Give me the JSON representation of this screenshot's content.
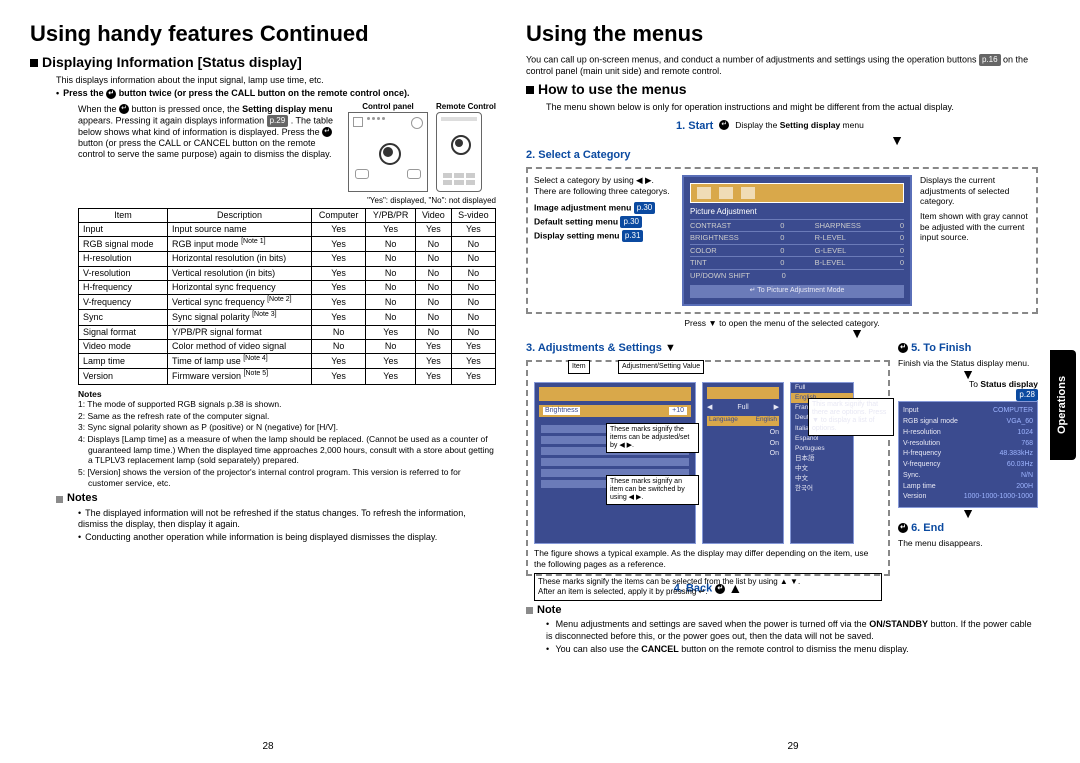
{
  "left": {
    "h1": "Using handy features Continued",
    "h2": "Displaying Information [Status display]",
    "intro": "This displays information about the input signal, lamp use time, etc.",
    "step_line_a": "Press the ",
    "step_line_b": " button twice (or press the CALL button on the remote control once).",
    "explain_a": "When the ",
    "explain_b": " button is pressed once, the ",
    "explain_c": "Setting display menu",
    "explain_d": " appears. Pressing it again displays information ",
    "explain_e": " . The table below shows what kind of information is displayed. Press the ",
    "explain_f": " button (or press the CALL or CANCEL button on the remote control to serve the same purpose) again to dismiss the display.",
    "page_ref_small": "p.29",
    "panel_label": "Control panel",
    "remote_label": "Remote Control",
    "table_legend": "\"Yes\": displayed, \"No\": not displayed",
    "table": {
      "head": [
        "Item",
        "Description",
        "Computer",
        "Y/PB/PR",
        "Video",
        "S-video"
      ],
      "rows": [
        [
          "Input",
          "Input source name",
          "Yes",
          "Yes",
          "Yes",
          "Yes"
        ],
        [
          "RGB signal mode",
          "RGB input mode [Note 1]",
          "Yes",
          "No",
          "No",
          "No"
        ],
        [
          "H-resolution",
          "Horizontal resolution (in bits)",
          "Yes",
          "No",
          "No",
          "No"
        ],
        [
          "V-resolution",
          "Vertical resolution (in bits)",
          "Yes",
          "No",
          "No",
          "No"
        ],
        [
          "H-frequency",
          "Horizontal sync frequency",
          "Yes",
          "No",
          "No",
          "No"
        ],
        [
          "V-frequency",
          "Vertical sync frequency [Note 2]",
          "Yes",
          "No",
          "No",
          "No"
        ],
        [
          "Sync",
          "Sync signal polarity [Note 3]",
          "Yes",
          "No",
          "No",
          "No"
        ],
        [
          "Signal format",
          "Y/PB/PR signal format",
          "No",
          "Yes",
          "No",
          "No"
        ],
        [
          "Video mode",
          "Color method of video signal",
          "No",
          "No",
          "Yes",
          "Yes"
        ],
        [
          "Lamp time",
          "Time of lamp use [Note 4]",
          "Yes",
          "Yes",
          "Yes",
          "Yes"
        ],
        [
          "Version",
          "Firmware version [Note 5]",
          "Yes",
          "Yes",
          "Yes",
          "Yes"
        ]
      ]
    },
    "notes_head": "Notes",
    "notes": [
      "1: The mode of supported RGB signals p.38 is shown.",
      "2: Same as the refresh rate of the computer signal.",
      "3: Sync signal polarity shown as P (positive) or N (negative) for [H/V].",
      "4: Displays [Lamp time] as a measure of when the lamp should be replaced. (Cannot be used as a counter of guaranteed lamp time.) When the displayed time approaches 2,000 hours, consult with a store about getting a TLPLV3 replacement lamp (sold separately) prepared.",
      "5: [Version] shows the version of the projector's internal control program. This version is referred to for customer service, etc."
    ],
    "notes2_head": "Notes",
    "notes2": [
      "The displayed information will not be refreshed if the status changes. To refresh the information, dismiss the display, then display it again.",
      "Conducting another operation while information is being displayed dismisses the display."
    ],
    "page_num": "28"
  },
  "right": {
    "h1": "Using the menus",
    "intro_a": "You can call up on-screen menus, and conduct a number of adjustments and settings using the operation buttons ",
    "intro_ref": "p.16",
    "intro_b": " on the control panel (main unit side) and remote control.",
    "h2": "How to use the menus",
    "h2_sub": "The menu shown below is only for operation instructions and might be different from the actual display.",
    "step1": "1. Start",
    "step1_text_a": "Display the ",
    "step1_text_b": "Setting display",
    "step1_text_c": " menu",
    "step2": "2. Select a Category",
    "step2_text": "Select a category by using ◀ ▶.\nThere are following three categorys.",
    "menu_img": "Image adjustment menu",
    "menu_def": "Default setting menu",
    "menu_disp": "Display setting menu",
    "ref30": "p.30",
    "ref31": "p.31",
    "osd_title": "Picture Adjustment",
    "osd_rows": [
      [
        "CONTRAST",
        "0",
        "SHARPNESS",
        "0"
      ],
      [
        "BRIGHTNESS",
        "0",
        "R-LEVEL",
        "0"
      ],
      [
        "COLOR",
        "0",
        "G-LEVEL",
        "0"
      ],
      [
        "TINT",
        "0",
        "B-LEVEL",
        "0"
      ],
      [
        "UP/DOWN SHIFT",
        "0",
        "",
        ""
      ]
    ],
    "osd_foot": "↵ To Picture Adjustment Mode",
    "osd_side_a": "Displays the current adjustments of selected category.",
    "osd_side_b": "Item shown with gray cannot be adjusted with the current input source.",
    "press_open": "Press ▼ to open the menu of the selected category.",
    "step3": "3. Adjustments & Settings",
    "callout_item": "Item",
    "callout_val": "Adjustment/Setting Value",
    "callout_marks1": "These marks signify the items can be adjusted/set by ◀ ▶.",
    "callout_marks2": "These marks signify an item can be switched by using ◀ ▶.",
    "callout_marks3": "This mark signify that there are options. Press ▼ to display a list of options.",
    "step3_text": "The figure shows a typical example. As the display may differ depending on the item, use the following pages as a reference.",
    "step3_box": "These marks signify the items can be selected from the list by using ▲ ▼.\nAfter an item is selected, apply it by pressing ↵.",
    "step4": "4. Back",
    "step5": "5. To Finish",
    "step5_text": "Finish via the Status display menu.",
    "to_status": "To Status display",
    "ref28": "p.28",
    "status_osd": {
      "rows": [
        [
          "Input",
          "COMPUTER"
        ],
        [
          "RGB signal mode",
          "VGA_60"
        ],
        [
          "H-resolution",
          "1024"
        ],
        [
          "V-resolution",
          "768"
        ],
        [
          "H-frequency",
          "48.383kHz"
        ],
        [
          "V-frequency",
          "60.03Hz"
        ],
        [
          "Sync.",
          "N/N"
        ],
        [
          "Lamp time",
          "200H"
        ],
        [
          "Version",
          "1000-1000-1000-1000"
        ]
      ]
    },
    "step6": "6. End",
    "step6_text": "The menu disappears.",
    "note_head": "Note",
    "note1_a": "Menu adjustments and settings are saved when the power is turned off via the ",
    "note1_b": "ON/STANDBY",
    "note1_c": " button. If the power cable is disconnected before this, or the power goes out, then the data will not be saved.",
    "note2_a": "You can also use the ",
    "note2_b": "CANCEL",
    "note2_c": " button on the remote control to dismiss the menu display.",
    "side_tab": "Operations",
    "page_num": "29",
    "lang_list": [
      "Full",
      "English",
      "Francais",
      "Deutsch",
      "Italiano",
      "Espanol",
      "Portugues",
      "日本語",
      "中文",
      "中文",
      "한국어"
    ]
  }
}
